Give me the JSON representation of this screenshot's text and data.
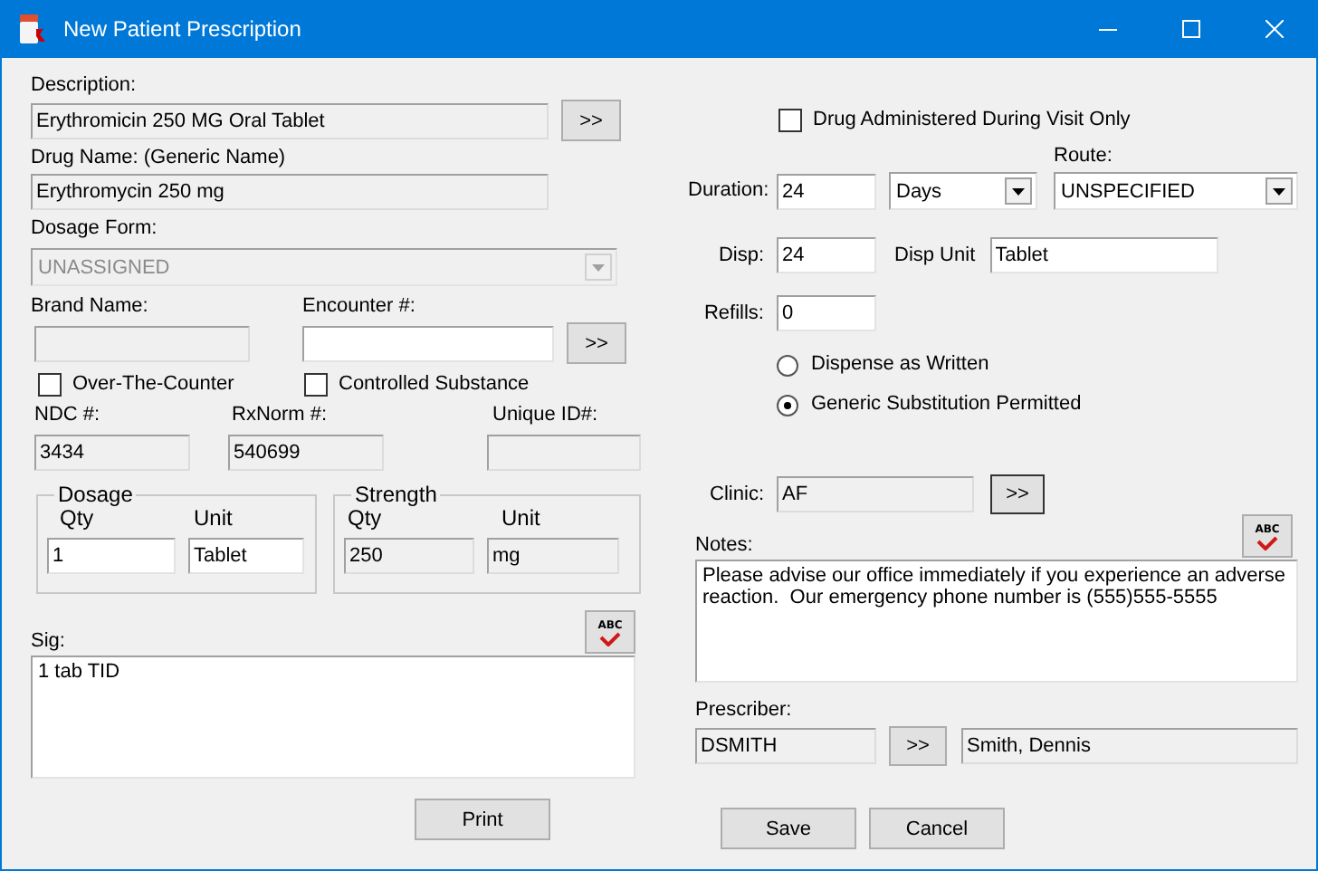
{
  "window": {
    "title": "New Patient Prescription"
  },
  "description": {
    "label": "Description:",
    "value": "Erythromicin 250 MG Oral Tablet",
    "readonly": true,
    "button": ">>"
  },
  "drug_name": {
    "label": "Drug Name: (Generic Name)",
    "value": "Erythromycin 250 mg",
    "readonly": true
  },
  "dosage_form": {
    "label": "Dosage Form:",
    "value": "UNASSIGNED",
    "disabled": true
  },
  "brand_name": {
    "label": "Brand Name:",
    "readonly": true
  },
  "encounter": {
    "label": "Encounter #:",
    "readonly": false,
    "button": ">>"
  },
  "checkboxes": [
    {
      "label": "Over-The-Counter",
      "checked": false
    },
    {
      "label": "Controlled Substance",
      "checked": false
    }
  ],
  "ids": [
    {
      "label": "NDC #:",
      "value": "3434",
      "readonly": true
    },
    {
      "label": "RxNorm #:",
      "value": "540699",
      "readonly": true
    },
    {
      "label": "Unique ID#:",
      "readonly": true
    }
  ],
  "groups": [
    {
      "title": "Dosage",
      "qty_label": "Qty",
      "unit_label": "Unit",
      "qty": "1",
      "unit": "Tablet",
      "readonly": false
    },
    {
      "title": "Strength",
      "qty_label": "Qty",
      "unit_label": "Unit",
      "qty": "250",
      "unit": "mg",
      "readonly": true
    }
  ],
  "sig": {
    "label": "Sig:",
    "spell_button": "ABC",
    "value": "1 tab TID"
  },
  "print_button": "Print",
  "administered_only": {
    "label": "Drug Administered During Visit Only",
    "checked": false
  },
  "duration": {
    "label": "Duration:",
    "value": "24",
    "unit": "Days"
  },
  "route": {
    "label": "Route:",
    "value": "UNSPECIFIED"
  },
  "disp": {
    "label": "Disp:",
    "value": "24",
    "unit_label": "Disp Unit",
    "unit": "Tablet"
  },
  "refills": {
    "label": "Refills:",
    "value": "0"
  },
  "substitution": [
    {
      "label": "Dispense as Written",
      "selected": false
    },
    {
      "label": "Generic Substitution Permitted",
      "selected": true
    }
  ],
  "clinic": {
    "label": "Clinic:",
    "value": "AF",
    "readonly": true,
    "button": ">>"
  },
  "notes": {
    "label": "Notes:",
    "spell_button": "ABC",
    "value": "Please advise our office immediately if you experience an adverse reaction.  Our emergency phone number is (555)555-5555"
  },
  "prescriber": {
    "label": "Prescriber:",
    "code": "DSMITH",
    "button": ">>",
    "name": "Smith, Dennis",
    "readonly": true
  },
  "buttons": [
    "Save",
    "Cancel"
  ]
}
